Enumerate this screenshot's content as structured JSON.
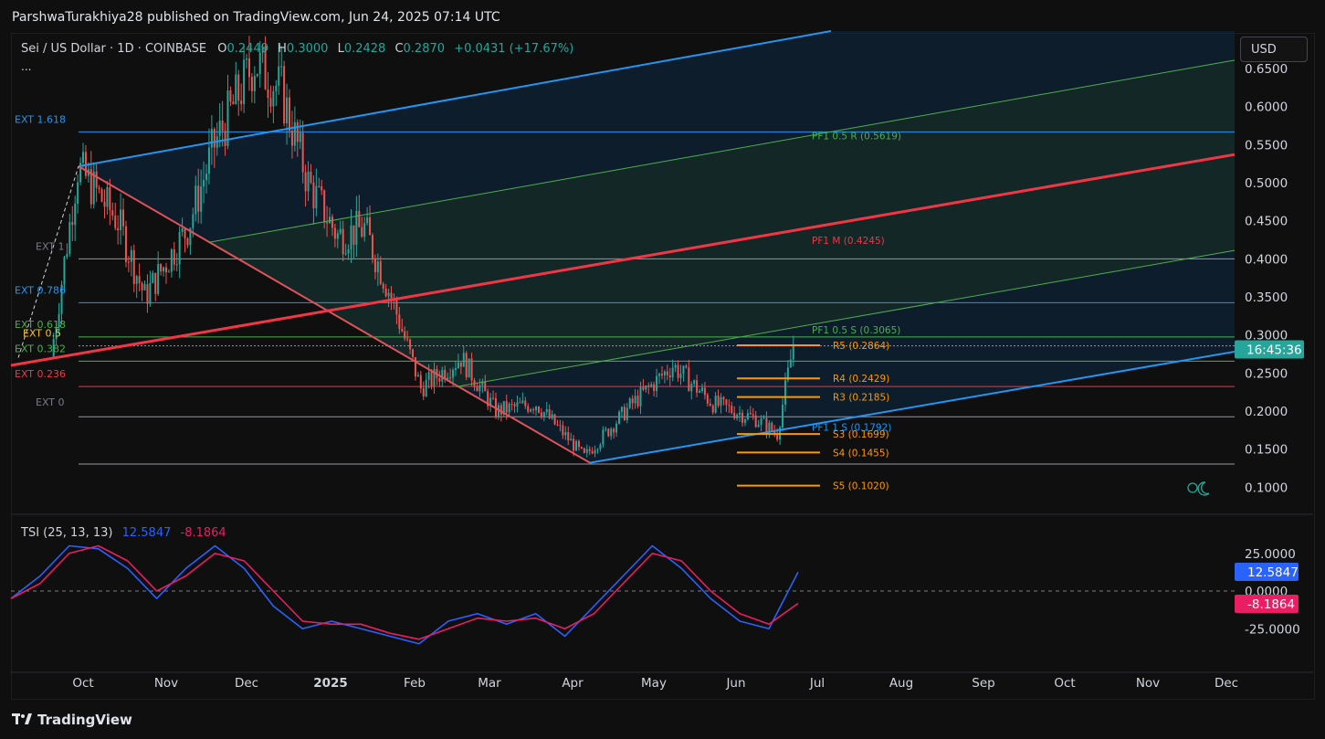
{
  "header": {
    "publisher": "ParshwaTurakhiya28 published on TradingView.com, Jun 24, 2025 07:14 UTC"
  },
  "symbol": {
    "title": "Sei / US Dollar · 1D · COINBASE",
    "open_label": "O",
    "open": "0.2449",
    "high_label": "H",
    "high": "0.3000",
    "low_label": "L",
    "low": "0.2428",
    "close_label": "C",
    "close": "0.2870",
    "change": "+0.0431 (+17.67%)",
    "more": "..."
  },
  "currency_button": "USD",
  "countdown": "16:45:36",
  "colors": {
    "up": "#26a69a",
    "down": "#ef5350",
    "channel": "#2196f3",
    "median": "#f23645",
    "pitchfork": "#4caf50",
    "pivot": "#ff9800",
    "tsi": "#2962ff",
    "tsi_signal": "#e91e63"
  },
  "chart_data": [
    {
      "type": "candlestick",
      "x_axis": {
        "tick_labels": [
          "Oct",
          "Nov",
          "Dec",
          "2025",
          "Feb",
          "Mar",
          "Apr",
          "May",
          "Jun",
          "Jul",
          "Aug",
          "Sep",
          "Oct",
          "Nov",
          "Dec"
        ]
      },
      "y_axis": {
        "tick_labels": [
          "0.6500",
          "0.6000",
          "0.5500",
          "0.5000",
          "0.4500",
          "0.4000",
          "0.3500",
          "0.3000",
          "0.2500",
          "0.2000",
          "0.1500",
          "0.1000"
        ],
        "ylim": [
          0.065,
          0.66
        ]
      },
      "last_price": 0.287,
      "fib_extensions": [
        {
          "label": "EXT 1.618",
          "value": 0.5667
        },
        {
          "label": "EXT 1",
          "value": 0.4
        },
        {
          "label": "EXT 0.786",
          "value": 0.3424
        },
        {
          "label": "EXT 0.618",
          "value": 0.2973
        },
        {
          "label": "EXT 0.5",
          "value": 0.2857
        },
        {
          "label": "EXT 0.382",
          "value": 0.2656
        },
        {
          "label": "EXT 0.236",
          "value": 0.2322
        },
        {
          "label": "EXT 0",
          "value": 0.1925
        }
      ],
      "pitchfork_labels": [
        {
          "label": "PF1 0.5 R (0.5619)",
          "value": 0.5619
        },
        {
          "label": "PF1 M (0.4245)",
          "value": 0.4245
        },
        {
          "label": "PF1 0.5 S (0.3065)",
          "value": 0.3065
        },
        {
          "label": "PF1 1 S (0.1792)",
          "value": 0.1792
        }
      ],
      "pivot_levels": [
        {
          "label": "R5 (0.2864)",
          "value": 0.2864
        },
        {
          "label": "R4 (0.2429)",
          "value": 0.2429
        },
        {
          "label": "R3 (0.2185)",
          "value": 0.2185
        },
        {
          "label": "S3 (0.1699)",
          "value": 0.1699
        },
        {
          "label": "S4 (0.1455)",
          "value": 0.1455
        },
        {
          "label": "S5 (0.1020)",
          "value": 0.102
        }
      ],
      "price_path": [
        {
          "date": "2024-09-20",
          "price": 0.27
        },
        {
          "date": "2024-09-30",
          "price": 0.52
        },
        {
          "date": "2024-10-15",
          "price": 0.45
        },
        {
          "date": "2024-10-25",
          "price": 0.35
        },
        {
          "date": "2024-11-10",
          "price": 0.44
        },
        {
          "date": "2024-11-20",
          "price": 0.55
        },
        {
          "date": "2024-12-05",
          "price": 0.66
        },
        {
          "date": "2024-12-15",
          "price": 0.62
        },
        {
          "date": "2024-12-25",
          "price": 0.5
        },
        {
          "date": "2025-01-05",
          "price": 0.43
        },
        {
          "date": "2025-01-15",
          "price": 0.44
        },
        {
          "date": "2025-01-25",
          "price": 0.35
        },
        {
          "date": "2025-02-05",
          "price": 0.23
        },
        {
          "date": "2025-02-20",
          "price": 0.27
        },
        {
          "date": "2025-03-05",
          "price": 0.2
        },
        {
          "date": "2025-03-20",
          "price": 0.21
        },
        {
          "date": "2025-04-07",
          "price": 0.14
        },
        {
          "date": "2025-04-25",
          "price": 0.21
        },
        {
          "date": "2025-05-10",
          "price": 0.26
        },
        {
          "date": "2025-05-25",
          "price": 0.21
        },
        {
          "date": "2025-06-10",
          "price": 0.19
        },
        {
          "date": "2025-06-18",
          "price": 0.17
        },
        {
          "date": "2025-06-24",
          "price": 0.287
        }
      ]
    },
    {
      "type": "line",
      "title": "TSI (25, 13, 13)",
      "series": [
        {
          "name": "12.5847",
          "values": [
            -5,
            10,
            30,
            28,
            15,
            -5,
            15,
            30,
            15,
            -10,
            -25,
            -20,
            -25,
            -30,
            -35,
            -20,
            -15,
            -22,
            -15,
            -30,
            -10,
            10,
            30,
            15,
            -5,
            -20,
            -25,
            12.5847
          ]
        },
        {
          "name": "-8.1864",
          "values": [
            -5,
            5,
            25,
            30,
            20,
            0,
            10,
            25,
            20,
            0,
            -20,
            -22,
            -22,
            -28,
            -32,
            -25,
            -18,
            -20,
            -18,
            -25,
            -15,
            5,
            25,
            20,
            0,
            -15,
            -22,
            -8.1864
          ]
        }
      ],
      "y_axis": {
        "tick_labels": [
          "25.0000",
          "0.0000",
          "-25.0000"
        ],
        "ylim": [
          -35,
          40
        ]
      }
    }
  ],
  "footer": {
    "brand": "TradingView"
  }
}
